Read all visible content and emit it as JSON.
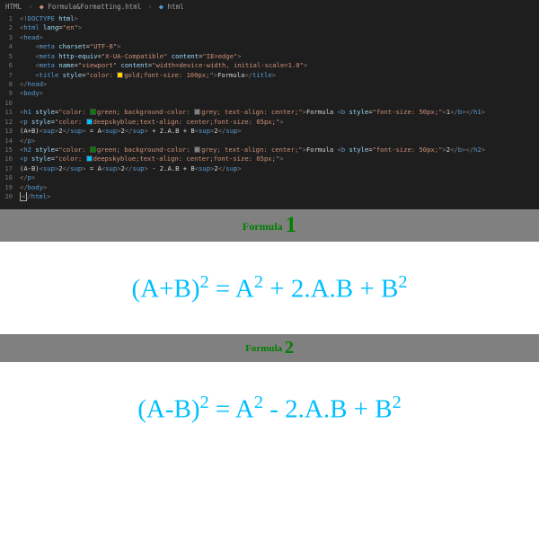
{
  "breadcrumb": {
    "a": "HTML",
    "b": "Formula&Formatting.html",
    "c": "html"
  },
  "lines": {
    "l1": "<!DOCTYPE html>",
    "l2": "<html lang=\"en\">",
    "l3": "<head>",
    "l4": "    <meta charset=\"UTF-8\">",
    "l5": "    <meta http-equiv=\"X-UA-Compatible\" content=\"IE=edge\">",
    "l6": "    <meta name=\"viewport\" content=\"width=device-width, initial-scale=1.0\">",
    "l7": "    <title style=\"color: gold;font-size: 100px;\">Formula</title>",
    "l8": "</head>",
    "l9": "<body>",
    "l10": "",
    "l11": "<h1 style=\"color: green; background-color: grey; text-align: center;\">Formula <b style=\"font-size: 50px;\">1</b></h1>",
    "l12": "<p style=\"color: deepskyblue;text-align: center;font-size: 65px;\">",
    "l13": "(A+B)<sup>2</sup> = A<sup>2</sup> + 2.A.B + B<sup>2</sup>",
    "l14": "</p>",
    "l15": "<h2 style=\"color: green; background-color: grey; text-align: center;\">Formula <b style=\"font-size: 50px;\">2</b></h2>",
    "l16": "<p style=\"color: deepskyblue;text-align: center;font-size: 65px;\">",
    "l17": "(A-B)<sup>2</sup> = A<sup>2</sup> - 2.A.B + B<sup>2</sup>",
    "l18": "</p>",
    "l19": "</body>",
    "l20": "</html>"
  },
  "preview": {
    "h1_label": "Formula ",
    "h1_num": "1",
    "formula1": "(A+B)<sup>2</sup> = A<sup>2</sup> + 2.A.B + B<sup>2</sup>",
    "h2_label": "Formula ",
    "h2_num": "2",
    "formula2": "(A-B)<sup>2</sup> = A<sup>2</sup> - 2.A.B + B<sup>2</sup>"
  }
}
